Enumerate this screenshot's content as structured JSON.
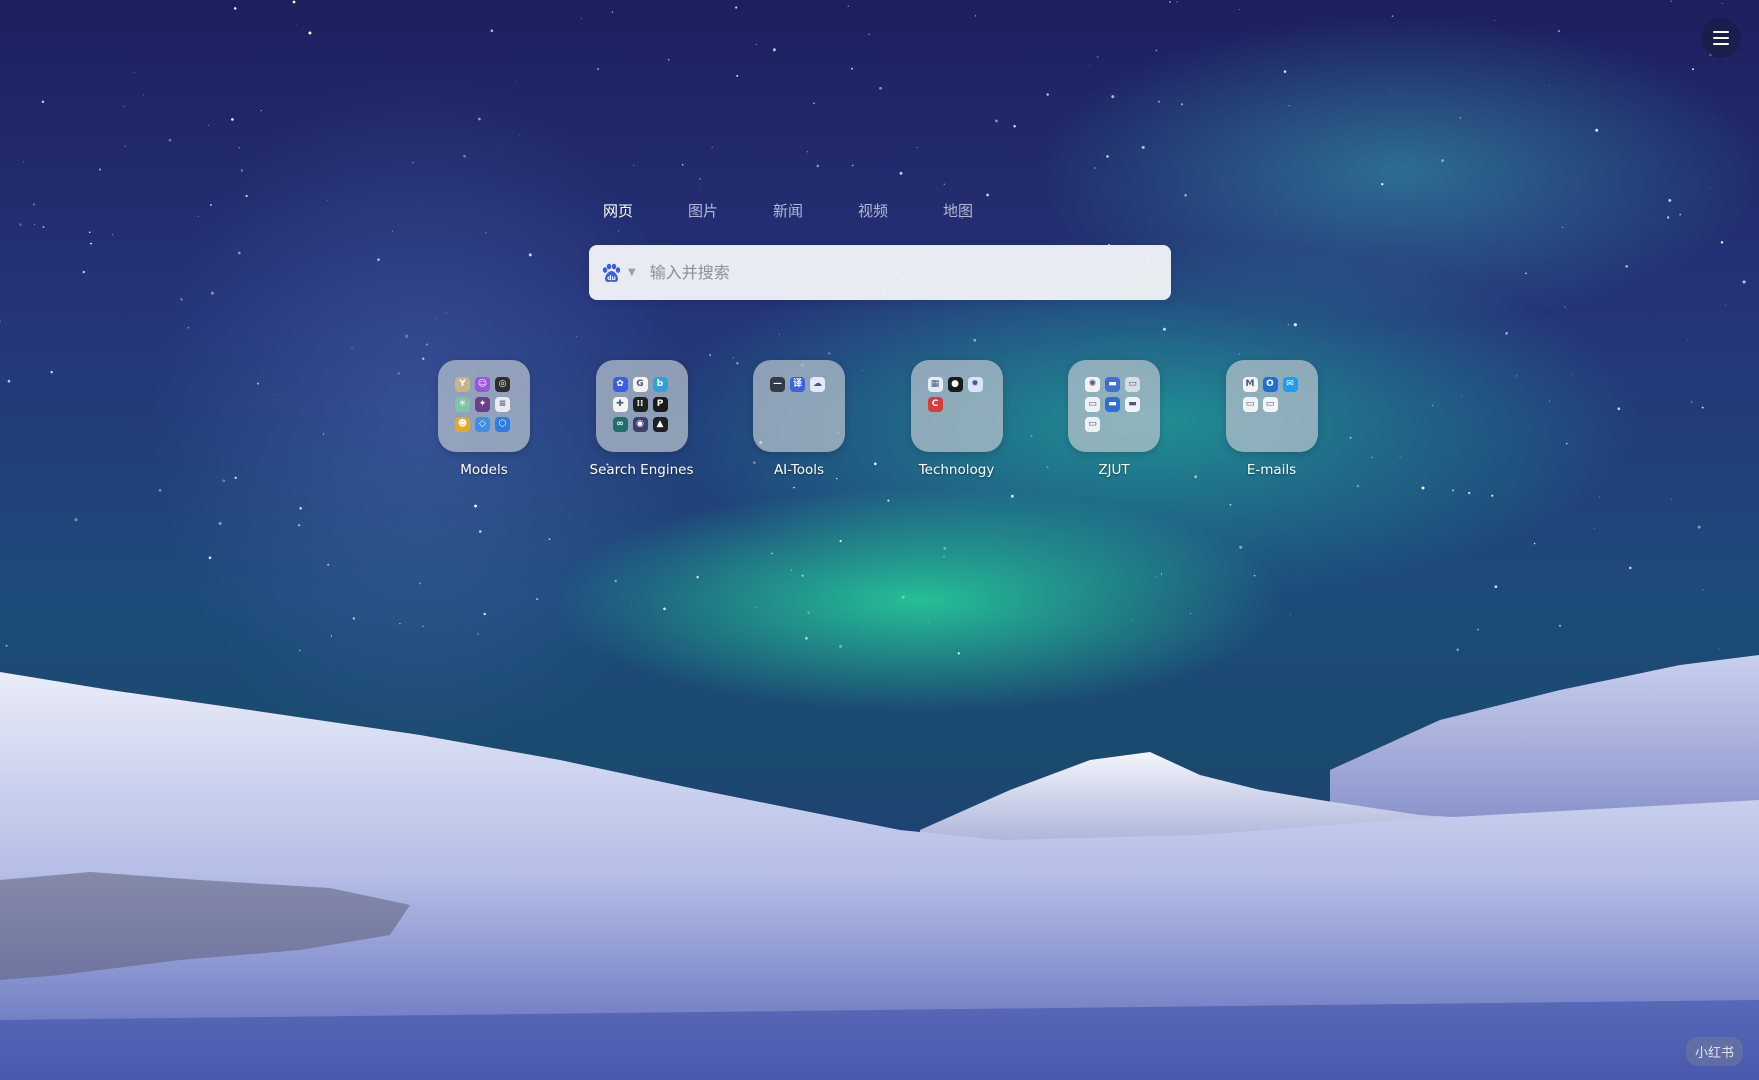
{
  "search_tabs": [
    {
      "label": "网页",
      "active": true
    },
    {
      "label": "图片",
      "active": false
    },
    {
      "label": "新闻",
      "active": false
    },
    {
      "label": "视频",
      "active": false
    },
    {
      "label": "地图",
      "active": false
    }
  ],
  "search": {
    "placeholder": "输入并搜索",
    "engine_icon": "baidu-paw-icon"
  },
  "folders": [
    {
      "label": "Models",
      "icons": [
        {
          "name": "yuanbao-icon",
          "color": "#c8b48a",
          "glyph": "Y"
        },
        {
          "name": "kimi-chat-icon",
          "color": "#9a58d8",
          "glyph": "☺"
        },
        {
          "name": "chatgpt-icon",
          "color": "#2e2e2e",
          "glyph": "◎"
        },
        {
          "name": "qwen-icon",
          "color": "#7fc3a8",
          "glyph": "✳"
        },
        {
          "name": "gemini-icon",
          "color": "#6b3f8a",
          "glyph": "✦"
        },
        {
          "name": "doc-icon",
          "color": "#e8ebef",
          "glyph": "≡"
        },
        {
          "name": "spark-icon",
          "color": "#e5a82a",
          "glyph": "☻"
        },
        {
          "name": "drop-icon",
          "color": "#3c8ee6",
          "glyph": "◇"
        },
        {
          "name": "cube-icon",
          "color": "#2f7be8",
          "glyph": "⬡"
        }
      ]
    },
    {
      "label": "Search Engines",
      "icons": [
        {
          "name": "baidu-icon",
          "color": "#3a5ee6",
          "glyph": "✿"
        },
        {
          "name": "google-icon",
          "color": "#f2f2f2",
          "glyph": "G"
        },
        {
          "name": "bing-icon",
          "color": "#2fa3d8",
          "glyph": "b"
        },
        {
          "name": "perplexity-spark-icon",
          "color": "#f4f4f4",
          "glyph": "✚"
        },
        {
          "name": "apps-grid-icon",
          "color": "#202020",
          "glyph": "⁞⁞"
        },
        {
          "name": "p-icon",
          "color": "#1a1a1a",
          "glyph": "P"
        },
        {
          "name": "metaso-icon",
          "color": "#1c6f6a",
          "glyph": "∞"
        },
        {
          "name": "globe-icon",
          "color": "#3c3f72",
          "glyph": "◉"
        },
        {
          "name": "arrow-icon",
          "color": "#1f1f1f",
          "glyph": "▲"
        }
      ]
    },
    {
      "label": "AI-Tools",
      "icons": [
        {
          "name": "link-icon",
          "color": "#333b48",
          "glyph": "—"
        },
        {
          "name": "translate-icon",
          "color": "#3c63e0",
          "glyph": "译"
        },
        {
          "name": "cloud-icon",
          "color": "#e3ebf8",
          "glyph": "☁"
        }
      ]
    },
    {
      "label": "Technology",
      "icons": [
        {
          "name": "grid-table-icon",
          "color": "#e3ecf7",
          "glyph": "▦"
        },
        {
          "name": "github-icon",
          "color": "#1a1a1a",
          "glyph": "●"
        },
        {
          "name": "compass-icon",
          "color": "#d9e6fa",
          "glyph": "✹"
        },
        {
          "name": "csdn-icon",
          "color": "#d73b3b",
          "glyph": "C"
        }
      ]
    },
    {
      "label": "ZJUT",
      "icons": [
        {
          "name": "school-emblem-icon",
          "color": "#f2f2f2",
          "glyph": "✺"
        },
        {
          "name": "portal-icon",
          "color": "#3e6fd1",
          "glyph": "▬"
        },
        {
          "name": "page-icon",
          "color": "#d7dde6",
          "glyph": "▭"
        },
        {
          "name": "page-icon",
          "color": "#eef1f5",
          "glyph": "▭"
        },
        {
          "name": "portal-icon",
          "color": "#2e6fd6",
          "glyph": "▬"
        },
        {
          "name": "bar-icon",
          "color": "#f1f3f6",
          "glyph": "▬"
        },
        {
          "name": "page-icon",
          "color": "#eef1f5",
          "glyph": "▭"
        }
      ]
    },
    {
      "label": "E-mails",
      "icons": [
        {
          "name": "gmail-icon",
          "color": "#f3f3f3",
          "glyph": "M"
        },
        {
          "name": "outlook-icon",
          "color": "#1d6fd6",
          "glyph": "O"
        },
        {
          "name": "mail-163-icon",
          "color": "#1f9bf0",
          "glyph": "✉"
        },
        {
          "name": "page-icon",
          "color": "#f1f3f6",
          "glyph": "▭"
        },
        {
          "name": "qq-mail-icon",
          "color": "#f4f4f4",
          "glyph": "▭"
        }
      ]
    }
  ],
  "watermark": "小红书",
  "menu_icon": "hamburger-menu-icon"
}
